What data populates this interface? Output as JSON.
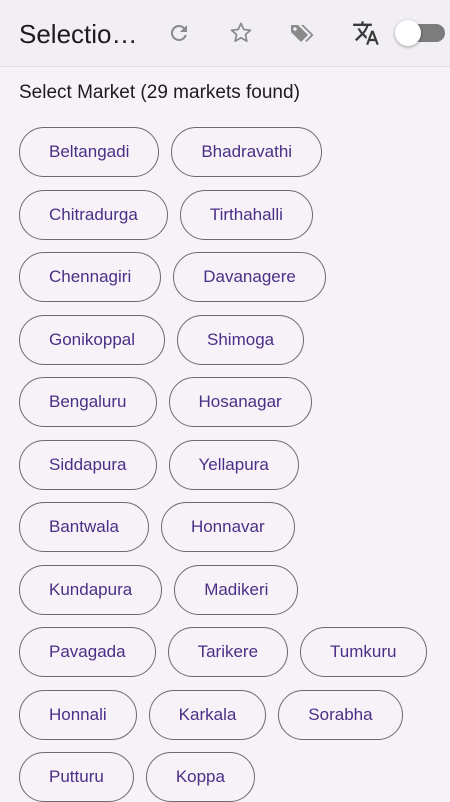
{
  "app_bar": {
    "title": "Selectio…",
    "icons": [
      "refresh-icon",
      "star-icon",
      "tags-icon",
      "translate-icon"
    ],
    "toggle_on": false
  },
  "subtitle": "Select Market (29 markets found)",
  "markets": [
    "Beltangadi",
    "Bhadravathi",
    "Chitradurga",
    "Tirthahalli",
    "Chennagiri",
    "Davanagere",
    "Gonikoppal",
    "Shimoga",
    "Bengaluru",
    "Hosanagar",
    "Siddapura",
    "Yellapura",
    "Bantwala",
    "Honnavar",
    "Kundapura",
    "Madikeri",
    "Pavagada",
    "Tarikere",
    "Tumkuru",
    "Honnali",
    "Karkala",
    "Sorabha",
    "Putturu",
    "Koppa"
  ],
  "colors": {
    "background": "#f6f2f8",
    "chip_text": "#4a2f86",
    "chip_border": "#6f6873",
    "icon": "#8a8a8a"
  }
}
